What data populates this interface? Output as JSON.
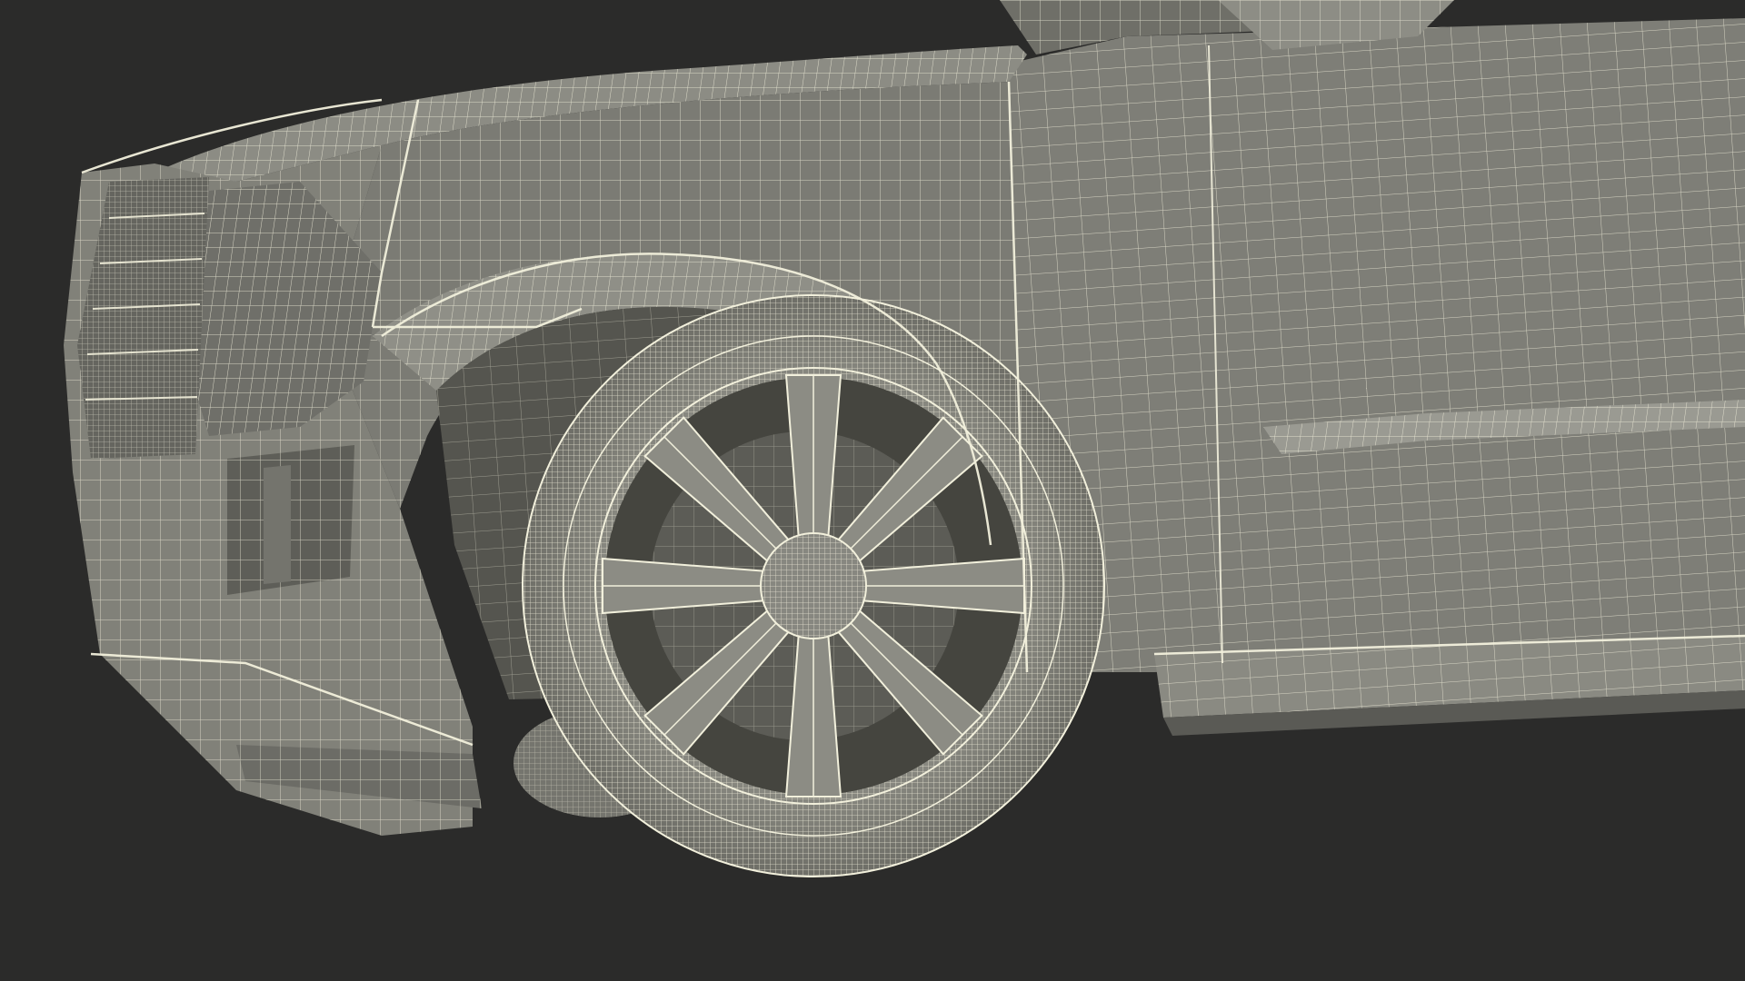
{
  "scene": {
    "subject": "suv-front-wireframe",
    "colors": {
      "background": "#2b2b2a",
      "surface": "#7b7b74",
      "surface_light": "#8c8c84",
      "surface_dark": "#5e5e58",
      "shadow": "#45453f",
      "wire": "#f2f0dc"
    },
    "wheel": {
      "spoke_count": 8
    }
  }
}
